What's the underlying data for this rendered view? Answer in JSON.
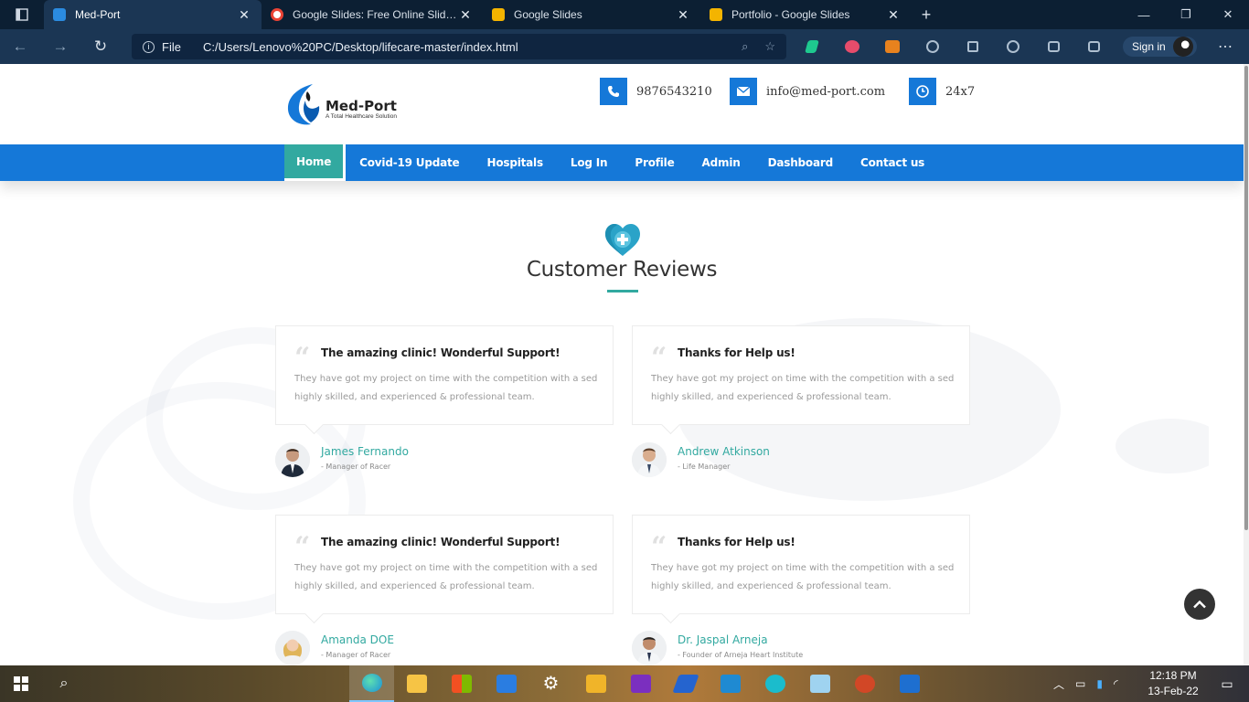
{
  "browser": {
    "tabs": [
      {
        "title": "Med-Port",
        "active": true,
        "favicon_color": "#2b8be0"
      },
      {
        "title": "Google Slides: Free Online Slides",
        "active": false,
        "favicon_color": "#ea4335"
      },
      {
        "title": "Google Slides",
        "active": false,
        "favicon_color": "#f4b400"
      },
      {
        "title": "Portfolio - Google Slides",
        "active": false,
        "favicon_color": "#f4b400"
      }
    ],
    "new_tab": "+",
    "scheme_label": "File",
    "url": "C:/Users/Lenovo%20PC/Desktop/lifecare-master/index.html",
    "signin_label": "Sign in",
    "menu_icon": "more-icon"
  },
  "site": {
    "logo_name": "Med-Port",
    "logo_tagline": "A Total Healthcare Solution",
    "phone": "9876543210",
    "email": "info@med-port.com",
    "hours": "24x7",
    "nav": [
      "Home",
      "Covid-19 Update",
      "Hospitals",
      "Log In",
      "Profile",
      "Admin",
      "Dashboard",
      "Contact us"
    ],
    "accent": "#1578d8",
    "accent_secondary": "#32a9a0"
  },
  "reviews": {
    "title": "Customer Reviews",
    "items": [
      {
        "headline": "The amazing clinic! Wonderful Support!",
        "body": "They have got my project on time with the competition with a sed highly skilled, and experienced & professional team.",
        "name": "James Fernando",
        "role": "- Manager of Racer"
      },
      {
        "headline": "Thanks for Help us!",
        "body": "They have got my project on time with the competition with a sed highly skilled, and experienced & professional team.",
        "name": "Andrew Atkinson",
        "role": "- Life Manager"
      },
      {
        "headline": "The amazing clinic! Wonderful Support!",
        "body": "They have got my project on time with the competition with a sed highly skilled, and experienced & professional team.",
        "name": "Amanda DOE",
        "role": "- Manager of Racer"
      },
      {
        "headline": "Thanks for Help us!",
        "body": "They have got my project on time with the competition with a sed highly skilled, and experienced & professional team.",
        "name": "Dr. Jaspal Arneja",
        "role": "- Founder of Arneja Heart Institute"
      }
    ]
  },
  "taskbar": {
    "time": "12:18 PM",
    "date": "13-Feb-22",
    "apps": [
      "edge",
      "file-explorer",
      "microsoft-store",
      "mail",
      "settings",
      "files",
      "onenote",
      "todo",
      "vscode",
      "canva",
      "notepad",
      "powerpoint",
      "media-player"
    ]
  }
}
